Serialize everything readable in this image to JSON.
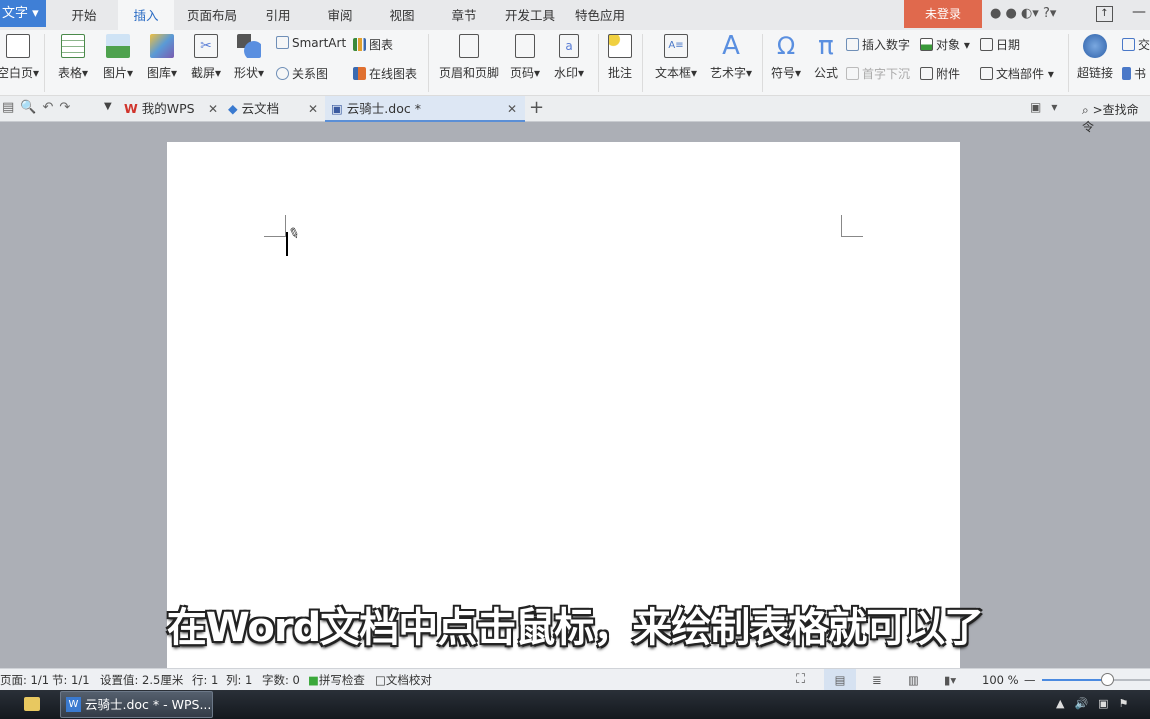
{
  "app_menu": "文字",
  "menu_tabs": [
    "开始",
    "插入",
    "页面布局",
    "引用",
    "审阅",
    "视图",
    "章节",
    "开发工具",
    "特色应用"
  ],
  "active_menu": "插入",
  "login": "未登录",
  "ribbon": {
    "big": [
      "空白页",
      "表格",
      "图片",
      "图库",
      "截屏",
      "形状",
      "页眉和页脚",
      "页码",
      "水印",
      "批注",
      "文本框",
      "艺术字",
      "符号",
      "公式",
      "超链接"
    ],
    "small": [
      "SmartArt",
      "图表",
      "关系图",
      "在线图表",
      "插入数字",
      "对象",
      "日期",
      "首字下沉",
      "附件",
      "文档部件",
      "交",
      "书"
    ]
  },
  "doc_tabs": [
    {
      "label": "我的WPS"
    },
    {
      "label": "云文档"
    },
    {
      "label": "云骑士.doc *"
    }
  ],
  "search": ">查找命令",
  "caption": "在Word文档中点击鼠标，来绘制表格就可以了",
  "status": {
    "page": "页面: 1/1",
    "section": "节: 1/1",
    "setting": "设置值: 2.5厘米",
    "row": "行: 1",
    "col": "列: 1",
    "words": "字数: 0",
    "spell": "拼写检查",
    "proof": "文档校对",
    "zoom": "100 %",
    "zoom_level": 0.5
  },
  "taskbar": {
    "window": "云骑士.doc * - WPS..."
  },
  "colors": {
    "accent": "#3f7fd6",
    "login": "#e0694d"
  }
}
